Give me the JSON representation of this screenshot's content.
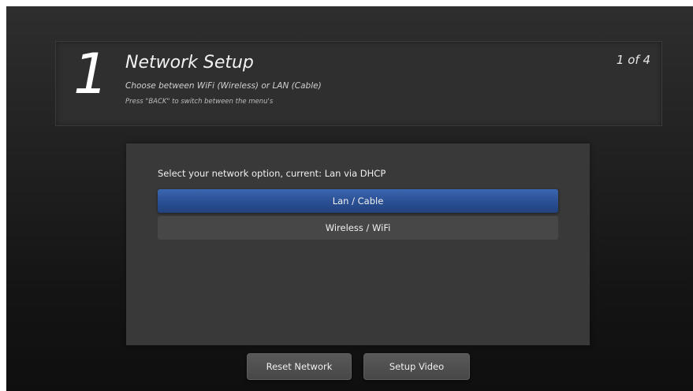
{
  "header": {
    "step_number": "1",
    "title": "Network Setup",
    "subtitle": "Choose between WiFi (Wireless) or LAN (Cable)",
    "hint": "Press \"BACK\" to switch between the menu's",
    "step_counter": "1 of 4"
  },
  "network": {
    "prompt": "Select your network option, current: Lan via DHCP",
    "options": [
      {
        "label": "Lan / Cable",
        "selected": true
      },
      {
        "label": "Wireless / WiFi",
        "selected": false
      }
    ]
  },
  "buttons": {
    "reset_label": "Reset Network",
    "video_label": "Setup Video"
  },
  "colors": {
    "selected_option": "#2a4f93",
    "panel": "#393939",
    "background": "#1e1e1e"
  }
}
